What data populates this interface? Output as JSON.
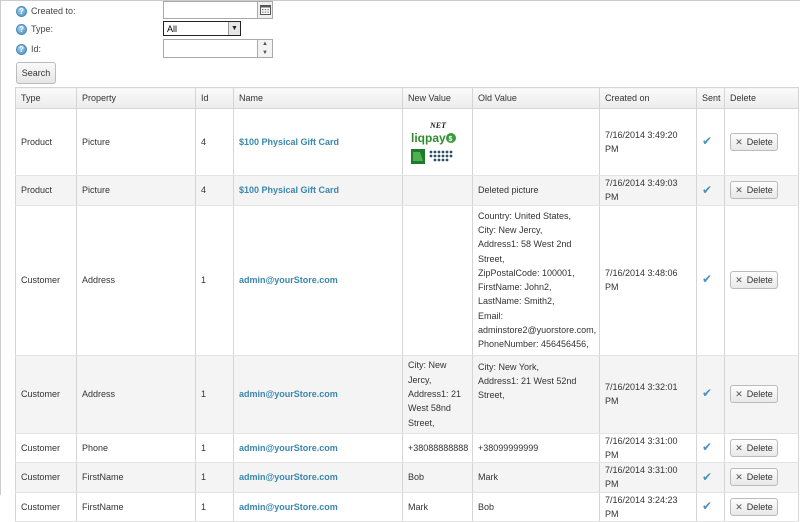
{
  "filters": {
    "created_to_label": "Created to:",
    "type_label": "Type:",
    "type_selected": "All",
    "id_label": "Id:",
    "search_label": "Search"
  },
  "table": {
    "headers": [
      "Type",
      "Property",
      "Id",
      "Name",
      "New Value",
      "Old Value",
      "Created on",
      "Sent",
      "Delete"
    ],
    "delete_label": "Delete",
    "rows": [
      {
        "type": "Product",
        "property": "Picture",
        "id": "4",
        "name": "$100 Physical Gift Card",
        "new_value": "",
        "new_value_image": "liqpay-logo",
        "old_value": "",
        "created_on": "7/16/2014 3:49:20 PM",
        "sent": true
      },
      {
        "type": "Product",
        "property": "Picture",
        "id": "4",
        "name": "$100 Physical Gift Card",
        "new_value": "",
        "old_value": "Deleted picture",
        "created_on": "7/16/2014 3:49:03 PM",
        "sent": true
      },
      {
        "type": "Customer",
        "property": "Address",
        "id": "1",
        "name": "admin@yourStore.com",
        "new_value": "",
        "old_value_lines": [
          "Country: United States,",
          "City: New Jercy,",
          "Address1: 58 West 2nd",
          "Street,",
          "ZipPostalCode: 100001,",
          "FirstName: John2,",
          "LastName: Smith2,",
          "Email:",
          "adminstore2@yuorstore.com,",
          "PhoneNumber: 456456456,"
        ],
        "created_on": "7/16/2014 3:48:06 PM",
        "sent": true
      },
      {
        "type": "Customer",
        "property": "Address",
        "id": "1",
        "name": "admin@yourStore.com",
        "new_value_lines": [
          "City: New",
          "Jercy,",
          "Address1: 21",
          "West 58nd",
          "Street,"
        ],
        "old_value_lines": [
          "City: New York,",
          "Address1: 21 West 52nd",
          "Street,"
        ],
        "created_on": "7/16/2014 3:32:01 PM",
        "sent": true
      },
      {
        "type": "Customer",
        "property": "Phone",
        "id": "1",
        "name": "admin@yourStore.com",
        "new_value": "+38088888888",
        "old_value": "+38099999999",
        "created_on": "7/16/2014 3:31:00 PM",
        "sent": true
      },
      {
        "type": "Customer",
        "property": "FirstName",
        "id": "1",
        "name": "admin@yourStore.com",
        "new_value": "Bob",
        "old_value": "Mark",
        "created_on": "7/16/2014 3:31:00 PM",
        "sent": true
      },
      {
        "type": "Customer",
        "property": "FirstName",
        "id": "1",
        "name": "admin@yourStore.com",
        "new_value": "Mark",
        "old_value": "Bob",
        "created_on": "7/16/2014 3:24:23 PM",
        "sent": true
      }
    ]
  },
  "logo": {
    "top_text": "NET",
    "brand": "liqpay",
    "brand_color": "#2f8f2f"
  },
  "colors": {
    "link": "#3a87ad",
    "check": "#4a8fbf"
  }
}
